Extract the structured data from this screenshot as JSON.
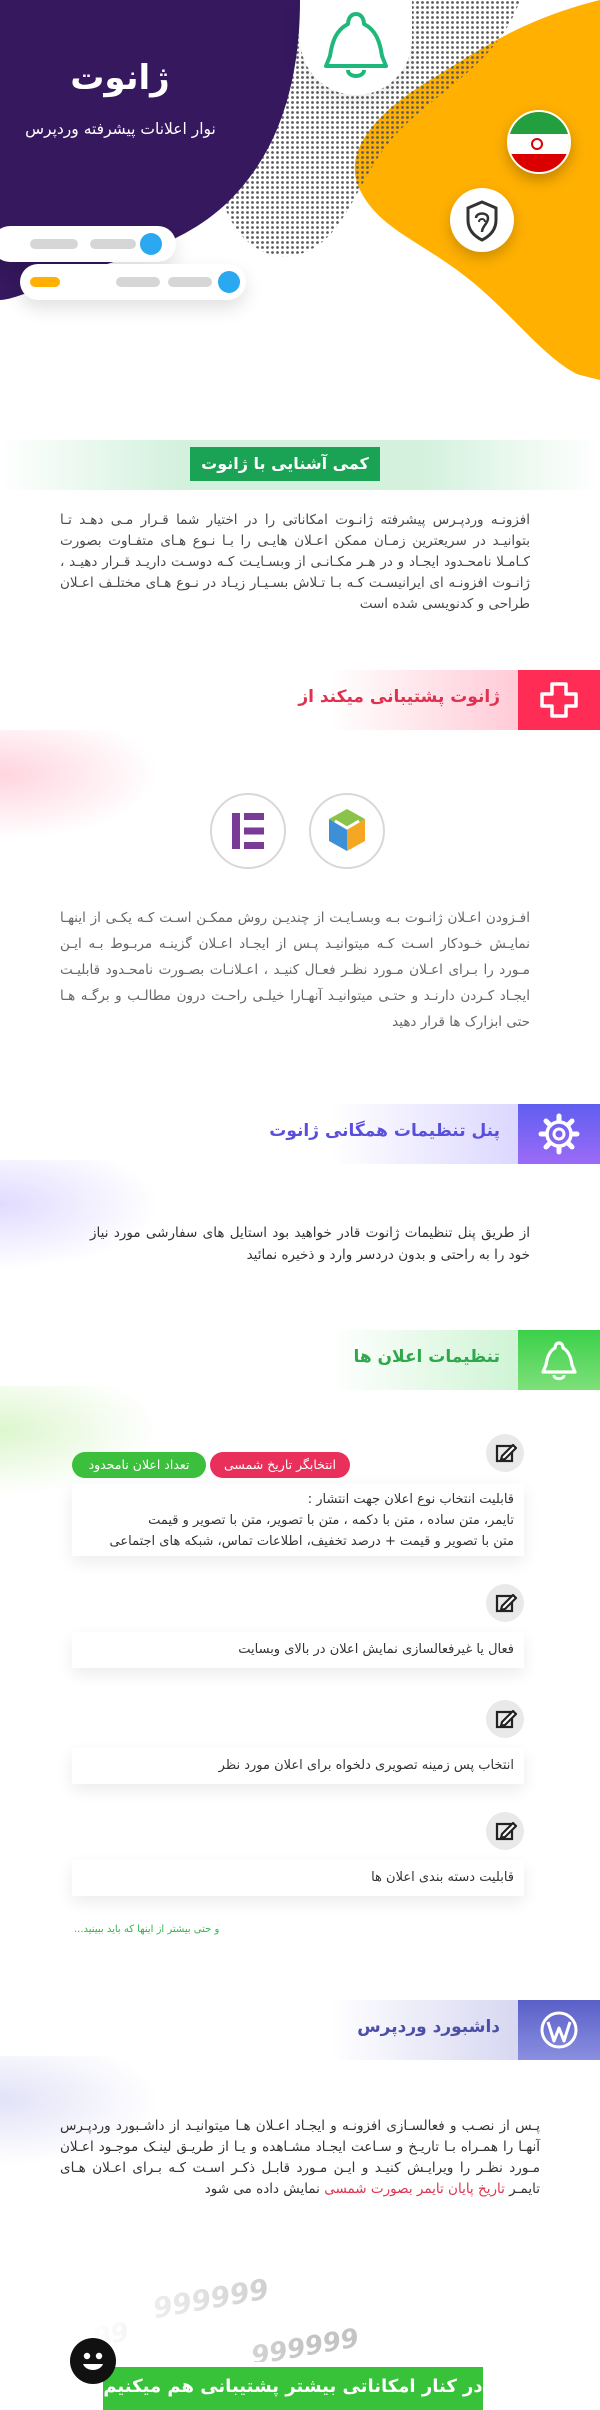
{
  "hero": {
    "title": "ژانوت",
    "subtitle": "نوار اعلانات پیشرفته وردپرس",
    "colors": {
      "purple": "#35185e",
      "yellow": "#ffb000",
      "gray": "#6c6c6c",
      "accent_blue": "#2aa8f0",
      "accent_yellow": "#ffb000"
    },
    "icons": [
      "bell-icon",
      "iran-flag-icon",
      "shield-icon"
    ]
  },
  "intro": {
    "banner": "کمی آشنایی با ژانوت",
    "text": "افزونـه وردپـرس پیشرفته ژانـوت امکاناتی را در اختیار شما قـرار مـی دهـد تـا بتوانیـد در سریعترین زمـان ممکن اعـلان هایـی را بـا نـوع هـای متفـاوت بصورت کـامـلا نامحـدود ایجـاد و در هـر مکـانـی از وبسـایـت کـه دوسـت داریـد قـرار دهیـد ، ژانـوت افزونـه ای ایرانیسـت کـه بـا تـلاش بسـیـار زیـاد در نـوع هـای مختلـف اعـلان طراحی و کدنویسی شده است"
  },
  "support": {
    "heading": "ژانوت پشتیبانی میکند از",
    "icons": [
      "plus-icon",
      "visual-composer-logo-icon",
      "elementor-logo-icon"
    ],
    "text": "افـزودن اعـلان ژانـوت بـه وبسـایـت از چندیـن روش ممکـن اسـت کـه یکـی از اینهـا نمایـش خـودکار اسـت کـه میتوانیـد پـس از ایجـاد اعـلان گزینـه مربـوط بـه ایـن مـورد را بـرای اعـلان مـورد نظـر فعـال کنیـد ، اعـلانـات بصـورت نامحـدود قابلیـت ایجـاد کـردن دارنـد و حتـی میتوانیـد آنهـارا خیلـی راحـت درون مطالـب و برگـه هـا حتی ابزارک ها قرار دهید"
  },
  "panel": {
    "heading": "پنل تنظیمات همگانی ژانوت",
    "icons": [
      "gear-icon"
    ],
    "text": "از طریق پنل تنظیمات ژانوت قادر خواهید بود استایل های سفارشی مورد نیاز خود را به راحتی و بدون دردسر وارد و ذخیره نمائید"
  },
  "settings": {
    "heading": "تنظیمات اعلان ها",
    "icons": [
      "bell-icon",
      "edit-icon"
    ],
    "chips": [
      "انتخابگر تاریخ شمسی",
      "تعداد اعلان نامحدود"
    ],
    "chip_colors": [
      "#e8305a",
      "#3cbf3c"
    ],
    "cards": [
      {
        "lines": [
          "قابلیت انتخاب نوع اعلان جهت انتشار :",
          "تایمر، متن ساده ، متن با دکمه ، متن با تصویر، متن با تصویر و قیمت",
          "متن با تصویر و قیمت + درصد تخفیف، اطلاعات تماس، شبکه های اجتماعی"
        ]
      },
      {
        "lines": [
          "فعال یا غیرفعالسازی نمایش اعلان در بالای وبسایت"
        ]
      },
      {
        "lines": [
          "انتخاب پس زمینه تصویری دلخواه برای اعلان مورد نظر"
        ]
      },
      {
        "lines": [
          "قابلیت دسته بندی اعلان ها"
        ]
      }
    ],
    "more_note": "و حتی بیشتر از اینها که باید ببینید..."
  },
  "dashboard": {
    "heading": "داشبورد وردپرس",
    "icons": [
      "wordpress-icon"
    ],
    "text_main": "پـس از نصـب و فعالسـازی افزونـه و ایجـاد اعـلان هـا میتوانیـد از داشـبورد وردپـرس آنهـا را همـراه بـا تاریـخ و سـاعت ایجـاد مشـاهده و یـا از طریـق لینـک موجـود اعـلان مـورد نظـر را ویرایـش کنیـد و ایـن مـورد قابـل ذکـر اسـت کـه بـرای اعـلان هـای تایمـر",
    "text_red": "تاریخ پایان تایمر بصورت شمسی",
    "text_tail": " نمایش داده می شود",
    "counter_text": "999999",
    "counter_text_2": "999999",
    "counter_text_3": "999999"
  },
  "footer": {
    "banner": "در کنار امکاناتی بیشتر پشتیبانی هم میکنیم",
    "icons": [
      "smiley-icon"
    ]
  }
}
